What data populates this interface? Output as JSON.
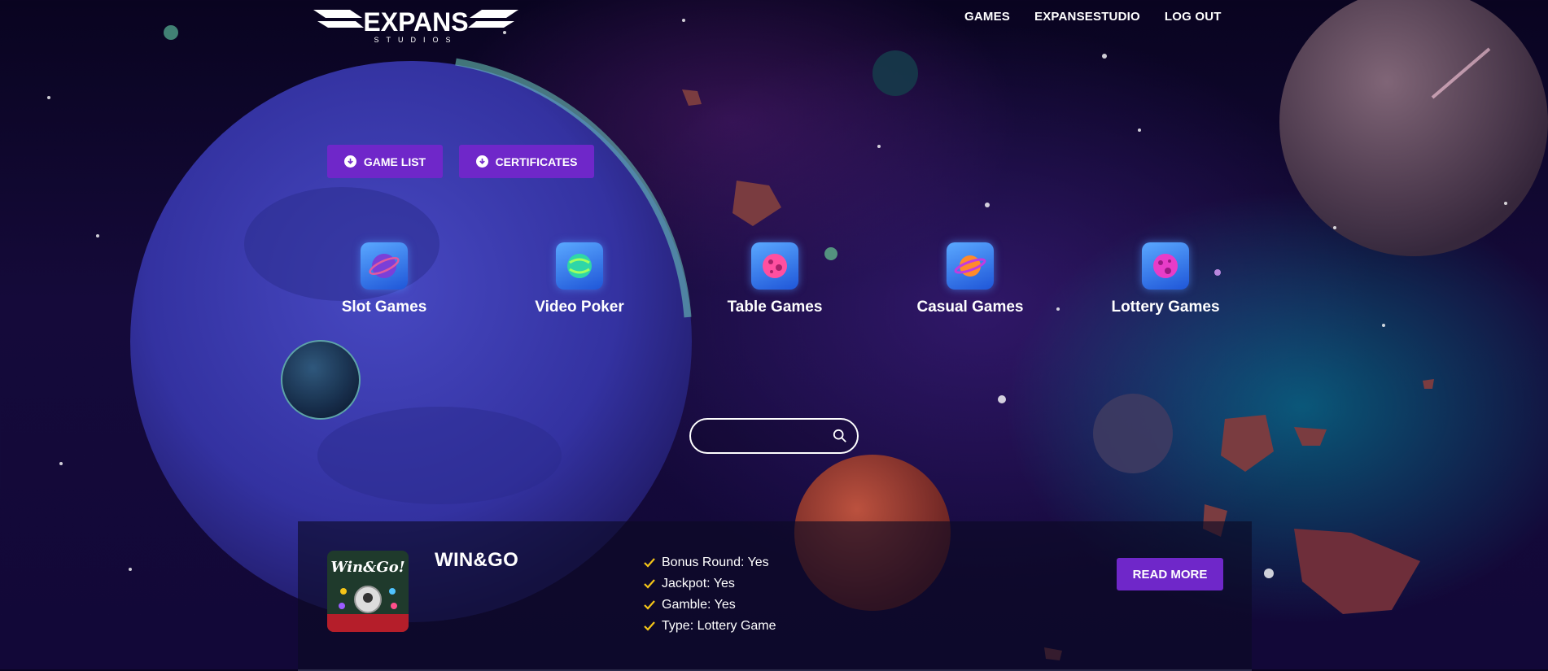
{
  "brand": {
    "logo_text": "EXPANS",
    "logo_sub": "STUDIOS"
  },
  "nav": {
    "games": "GAMES",
    "expansestudio": "EXPANSESTUDIO",
    "logout": "LOG OUT"
  },
  "downloads": {
    "game_list": "GAME LIST",
    "certificates": "CERTIFICATES"
  },
  "categories": [
    {
      "label": "Slot Games",
      "icon": "purple-planet-icon"
    },
    {
      "label": "Video Poker",
      "icon": "green-swirl-planet-icon"
    },
    {
      "label": "Table Games",
      "icon": "pink-cratered-planet-icon"
    },
    {
      "label": "Casual Games",
      "icon": "orange-ringed-planet-icon"
    },
    {
      "label": "Lottery Games",
      "icon": "magenta-planet-icon"
    }
  ],
  "search": {
    "placeholder": "",
    "icon": "search-icon"
  },
  "game": {
    "title": "WIN&GO",
    "thumb_text": "Win&Go!",
    "features": [
      "Bonus Round: Yes",
      "Jackpot: Yes",
      "Gamble: Yes",
      "Type: Lottery Game"
    ],
    "read_more": "READ MORE"
  },
  "colors": {
    "accent": "#6f27c9",
    "check": "#f5c518",
    "bg": "#120838"
  }
}
